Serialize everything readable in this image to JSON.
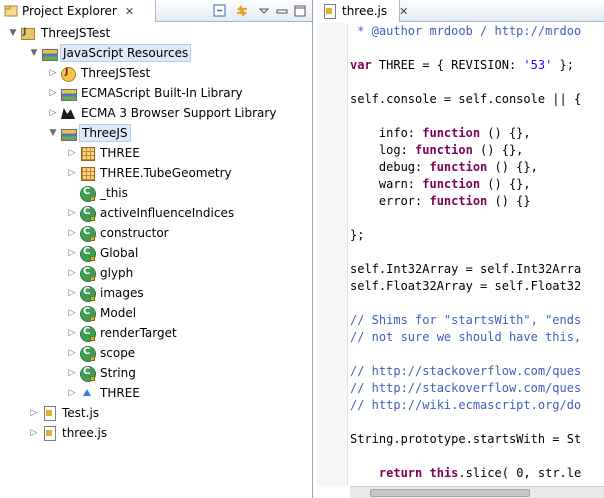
{
  "explorer": {
    "title": "Project Explorer",
    "close_glyph": "✕",
    "toolbar": [
      "collapse-all-icon",
      "link-with-editor-icon",
      "view-menu-icon",
      "minimize-icon",
      "maximize-icon"
    ],
    "tree": [
      {
        "label": "ThreeJSTest",
        "icon": "project-icon",
        "twisty": "▼"
      },
      {
        "label": "JavaScript Resources",
        "icon": "library-icon",
        "twisty": "▼"
      },
      {
        "label": "ThreeJSTest",
        "icon": "js-source-icon",
        "twisty": "▷"
      },
      {
        "label": "ECMAScript Built-In Library",
        "icon": "library-icon",
        "twisty": "▷"
      },
      {
        "label": "ECMA 3 Browser Support Library",
        "icon": "browser-library-icon",
        "twisty": "▷"
      },
      {
        "label": "ThreeJS",
        "icon": "library-icon",
        "twisty": "▼"
      },
      {
        "label": "THREE",
        "icon": "namespace-icon",
        "twisty": "▷"
      },
      {
        "label": "THREE.TubeGeometry",
        "icon": "namespace-icon",
        "twisty": "▷"
      },
      {
        "label": "_this",
        "icon": "class-icon",
        "twisty": ""
      },
      {
        "label": "activeInfluenceIndices",
        "icon": "class-icon",
        "twisty": "▷"
      },
      {
        "label": "constructor",
        "icon": "class-icon",
        "twisty": "▷"
      },
      {
        "label": "Global",
        "icon": "class-icon",
        "twisty": "▷"
      },
      {
        "label": "glyph",
        "icon": "class-icon",
        "twisty": "▷"
      },
      {
        "label": "images",
        "icon": "class-icon",
        "twisty": "▷"
      },
      {
        "label": "Model",
        "icon": "class-icon",
        "twisty": "▷"
      },
      {
        "label": "renderTarget",
        "icon": "class-icon",
        "twisty": "▷"
      },
      {
        "label": "scope",
        "icon": "class-icon",
        "twisty": "▷"
      },
      {
        "label": "String",
        "icon": "class-icon",
        "twisty": "▷"
      },
      {
        "label": "THREE",
        "icon": "field-icon",
        "twisty": "▷"
      },
      {
        "label": "Test.js",
        "icon": "js-file-icon",
        "twisty": "▷"
      },
      {
        "label": "three.js",
        "icon": "js-file-icon",
        "twisty": "▷"
      }
    ]
  },
  "editor": {
    "tab_label": "three.js",
    "close_glyph": "✕",
    "lines": [
      " * @author mrdoob / http://mrdoo",
      "",
      "var THREE = { REVISION: '53' };",
      "",
      "self.console = self.console || {",
      "",
      "    info: function () {},",
      "    log: function () {},",
      "    debug: function () {},",
      "    warn: function () {},",
      "    error: function () {}",
      "",
      "};",
      "",
      "self.Int32Array = self.Int32Arra",
      "self.Float32Array = self.Float32",
      "",
      "// Shims for \"startsWith\", \"ends",
      "// not sure we should have this,",
      "",
      "// http://stackoverflow.com/ques",
      "// http://stackoverflow.com/ques",
      "// http://wiki.ecmascript.org/do",
      "",
      "String.prototype.startsWith = St",
      "",
      "    return this.slice( 0, str.le"
    ]
  }
}
